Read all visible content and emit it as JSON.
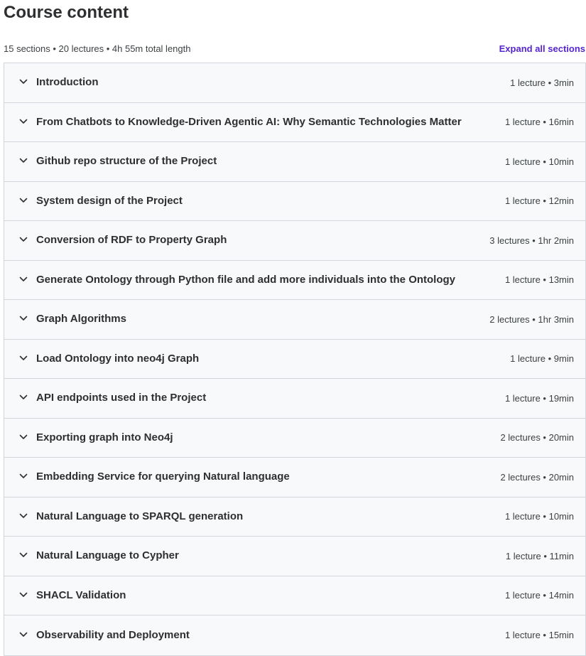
{
  "header": {
    "title": "Course content",
    "summary": "15 sections • 20 lectures • 4h 55m total length",
    "expand_label": "Expand all sections"
  },
  "colors": {
    "accent": "#5624d0",
    "section_bg": "#f7f9fa",
    "border": "#d1d7dc",
    "text": "#2d2f31"
  },
  "sections": [
    {
      "title": "Introduction",
      "meta": "1 lecture • 3min"
    },
    {
      "title": "From Chatbots to Knowledge-Driven Agentic AI: Why Semantic Technologies Matter",
      "meta": "1 lecture • 16min"
    },
    {
      "title": "Github repo structure of the Project",
      "meta": "1 lecture • 10min"
    },
    {
      "title": "System design of the Project",
      "meta": "1 lecture • 12min"
    },
    {
      "title": "Conversion of RDF to Property Graph",
      "meta": "3 lectures • 1hr 2min"
    },
    {
      "title": "Generate Ontology through Python file and add more individuals into the Ontology",
      "meta": "1 lecture • 13min"
    },
    {
      "title": "Graph Algorithms",
      "meta": "2 lectures • 1hr 3min"
    },
    {
      "title": "Load Ontology into neo4j Graph",
      "meta": "1 lecture • 9min"
    },
    {
      "title": "API endpoints used in the Project",
      "meta": "1 lecture • 19min"
    },
    {
      "title": "Exporting graph into Neo4j",
      "meta": "2 lectures • 20min"
    },
    {
      "title": "Embedding Service for querying Natural language",
      "meta": "2 lectures • 20min"
    },
    {
      "title": "Natural Language to SPARQL generation",
      "meta": "1 lecture • 10min"
    },
    {
      "title": "Natural Language to Cypher",
      "meta": "1 lecture • 11min"
    },
    {
      "title": "SHACL Validation",
      "meta": "1 lecture • 14min"
    },
    {
      "title": "Observability and Deployment",
      "meta": "1 lecture • 15min"
    }
  ]
}
